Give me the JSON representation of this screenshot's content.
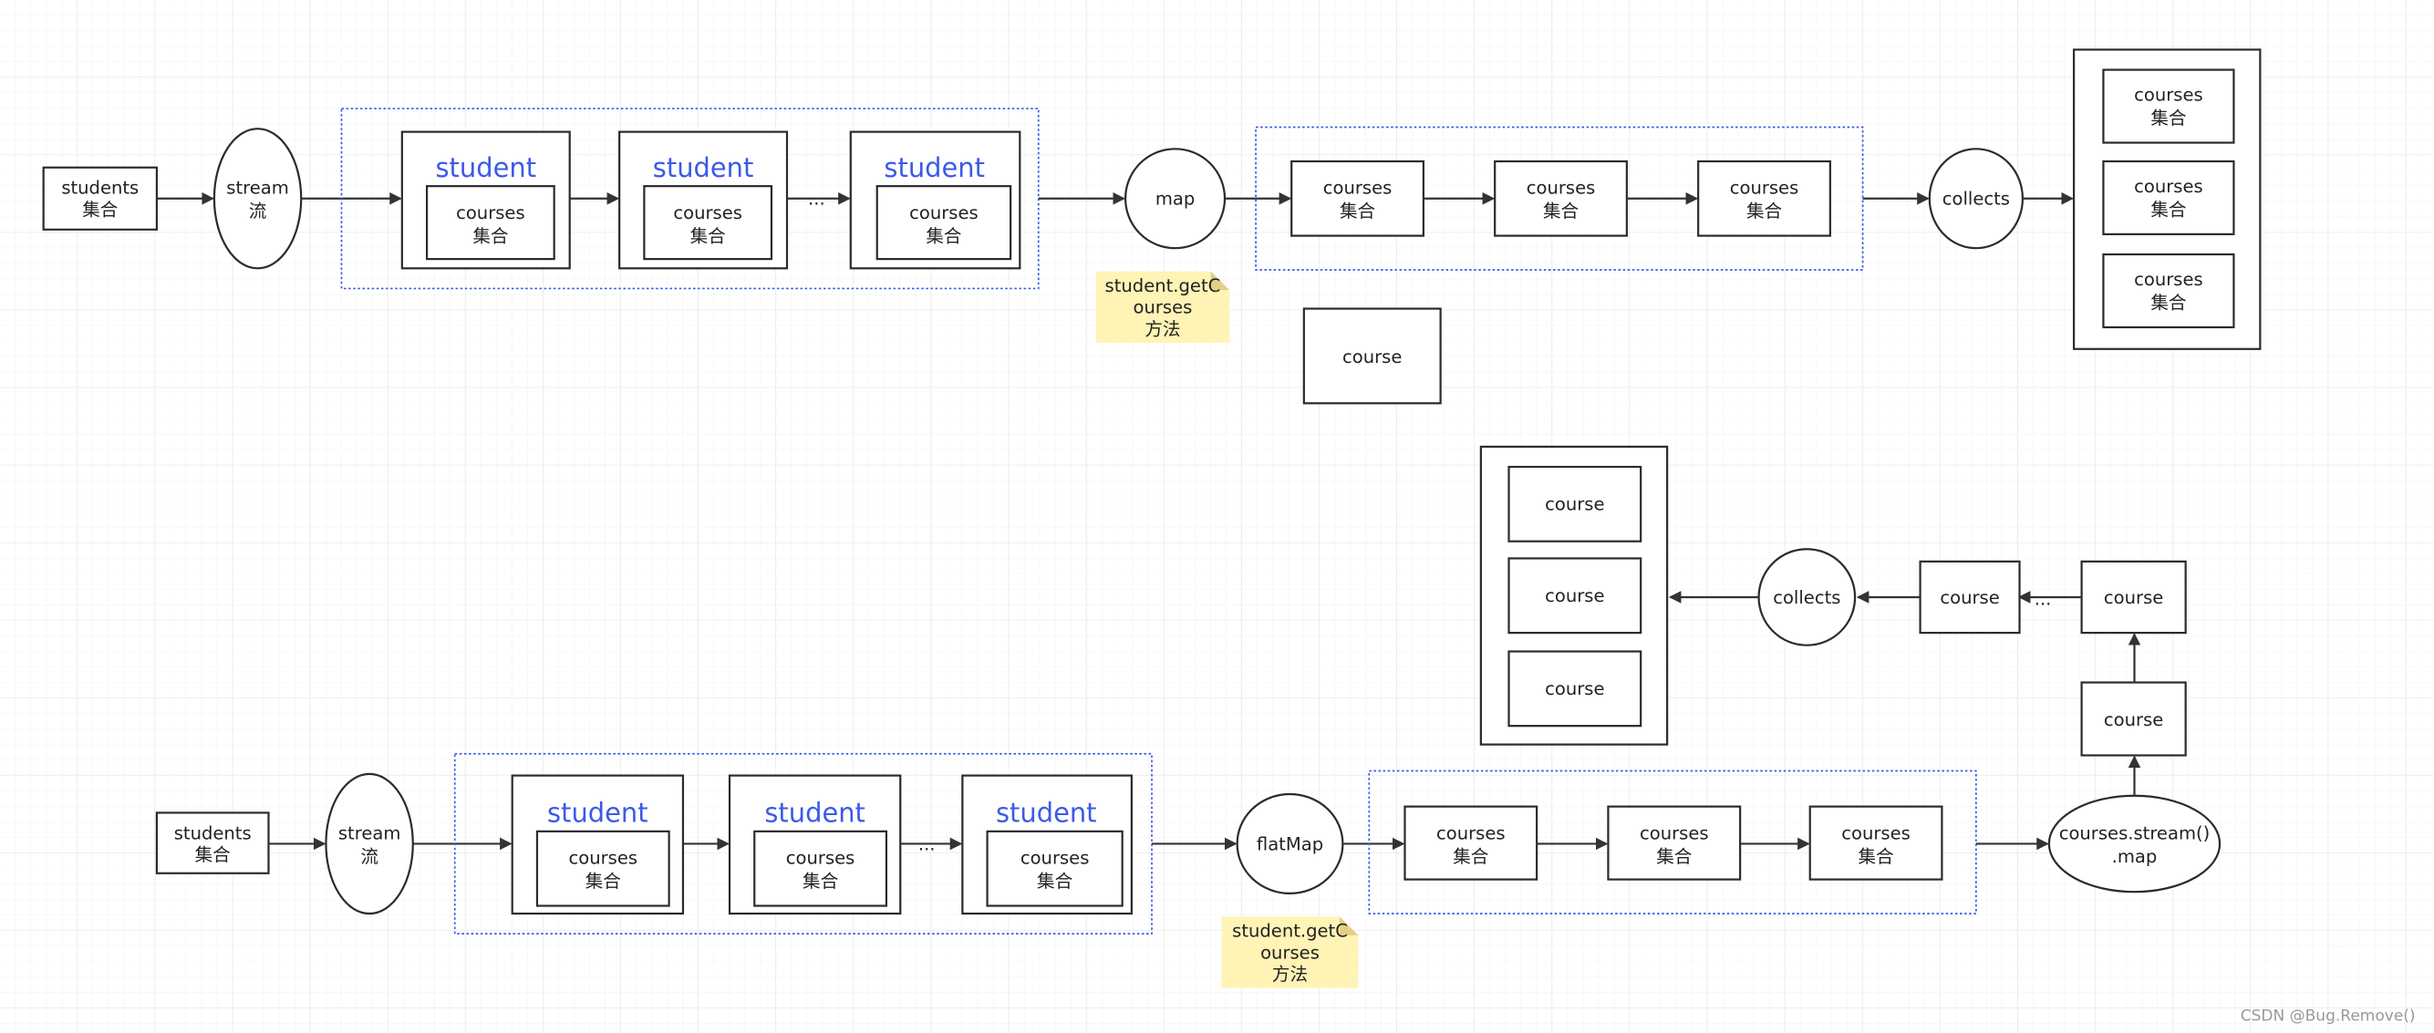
{
  "colors": {
    "student_label": "#3a5ae8",
    "container_border": "#3a5ae8",
    "note_fill": "#fff3b5",
    "stroke": "#2b2b2b"
  },
  "top": {
    "students": [
      "students",
      "集合"
    ],
    "stream": [
      "stream",
      "流"
    ],
    "student_label": "student",
    "courses": [
      "courses",
      "集合"
    ],
    "ellipsis": "...",
    "map": "map",
    "note": [
      "student.getC",
      "ourses",
      "方法"
    ],
    "collects": "collects",
    "course": "course"
  },
  "bottom": {
    "students": [
      "students",
      "集合"
    ],
    "stream": [
      "stream",
      "流"
    ],
    "student_label": "student",
    "courses": [
      "courses",
      "集合"
    ],
    "ellipsis": "...",
    "flatmap": "flatMap",
    "note": [
      "student.getC",
      "ourses",
      "方法"
    ],
    "stream_map": [
      "courses.stream()",
      ".map"
    ],
    "course": "course",
    "collects": "collects"
  },
  "watermark": "CSDN @Bug.Remove()"
}
